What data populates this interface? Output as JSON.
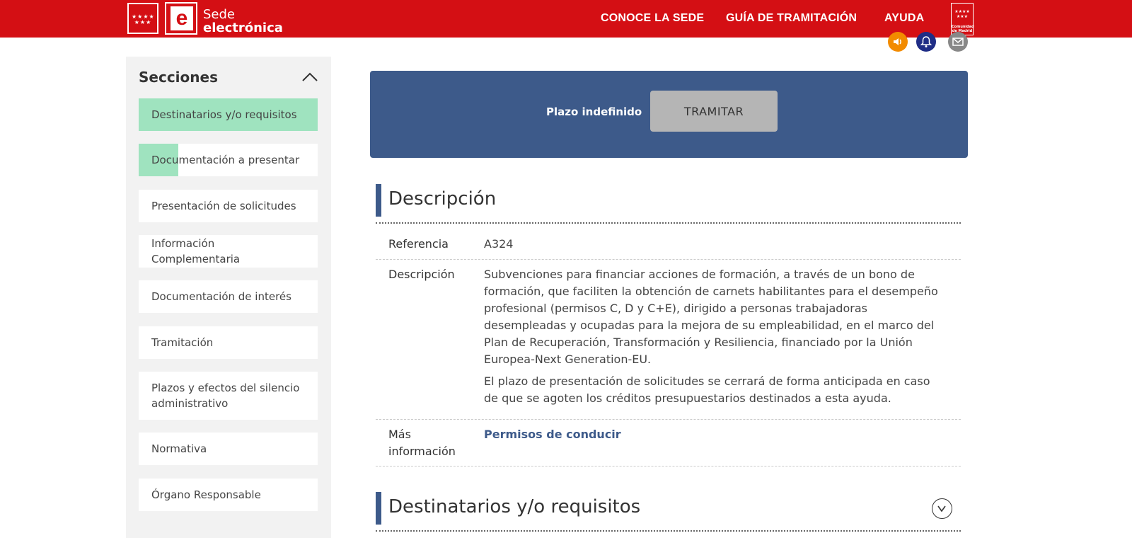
{
  "header": {
    "flag_stars": "★★★★ ★★★",
    "logo_letter": "e",
    "site_name_line1": "Sede",
    "site_name_line2": "electrónica",
    "nav": [
      "CONOCE LA SEDE",
      "GUÍA DE TRAMITACIÓN",
      "AYUDA"
    ],
    "cm_stars": "★★★★ ★★★",
    "cm_text": "Comunidad de Madrid"
  },
  "action_icons": [
    "audio-icon",
    "bell-icon",
    "mail-icon"
  ],
  "sidebar": {
    "title": "Secciones",
    "items": [
      {
        "label": "Destinatarios y/o requisitos",
        "state": "active"
      },
      {
        "label": "Documentación a presentar",
        "state": "partial",
        "progress": 0.22
      },
      {
        "label": "Presentación de solicitudes"
      },
      {
        "label": "Información Complementaria"
      },
      {
        "label": "Documentación de interés"
      },
      {
        "label": "Tramitación"
      },
      {
        "label": "Plazos y efectos del silencio administrativo"
      },
      {
        "label": "Normativa"
      },
      {
        "label": "Órgano Responsable"
      }
    ]
  },
  "tramitar": {
    "plazo": "Plazo indefinido",
    "button": "TRAMITAR"
  },
  "descripcion_section": {
    "title": "Descripción",
    "rows": {
      "referencia_label": "Referencia",
      "referencia_value": "A324",
      "descripcion_label": "Descripción",
      "descripcion_p1": "Subvenciones para financiar acciones de formación, a través de un bono de formación, que faciliten la obtención de carnets habilitantes para el desempeño profesional (permisos C, D y C+E), dirigido a personas trabajadoras desempleadas y ocupadas para la mejora de su empleabilidad, en el marco del Plan de Recuperación, Transformación y Resiliencia, financiado por la Unión Europea-Next Generation-EU.",
      "descripcion_p2": "El plazo de presentación de solicitudes se cerrará de forma anticipada en caso de que se agoten los créditos presupuestarios destinados a esta ayuda.",
      "mas_info_label": "Más información",
      "mas_info_link": "Permisos de conducir"
    }
  },
  "destinatarios_section": {
    "title": "Destinatarios y/o requisitos"
  }
}
